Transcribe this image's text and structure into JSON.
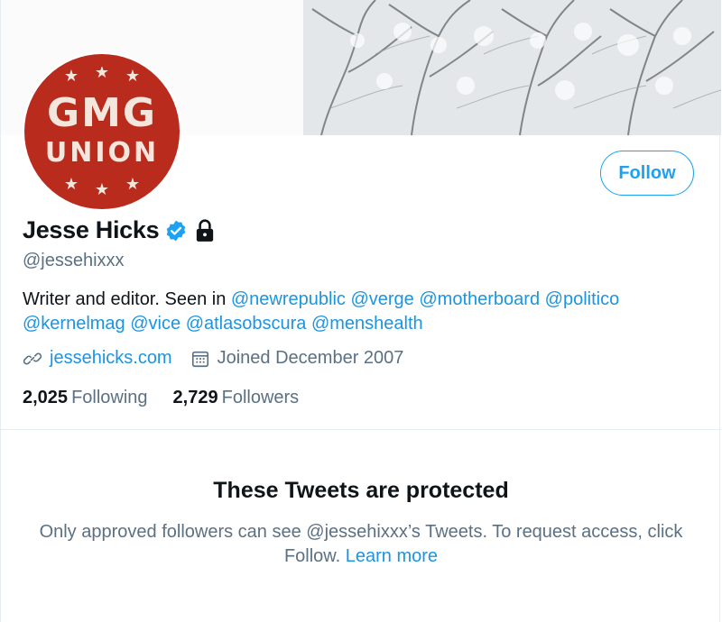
{
  "profile": {
    "name": "Jesse Hicks",
    "handle": "@jessehixxx",
    "avatar": {
      "line1": "GMG",
      "line2": "UNION"
    },
    "bio_prefix": "Writer and editor. Seen in",
    "mentions": [
      "@newrepublic",
      "@verge",
      "@motherboard",
      "@politico",
      "@kernelmag",
      "@vice",
      "@atlasobscura",
      "@menshealth"
    ],
    "website": "jessehicks.com",
    "joined": "Joined December 2007",
    "following_count": "2,025",
    "following_label": "Following",
    "followers_count": "2,729",
    "followers_label": "Followers"
  },
  "actions": {
    "follow_label": "Follow"
  },
  "protected": {
    "title": "These Tweets are protected",
    "text": "Only approved followers can see @jessehixxx’s Tweets. To request access, click Follow.",
    "learn_more": "Learn more"
  },
  "icons": {
    "verified": "verified-badge-icon",
    "locked": "lock-icon",
    "link": "link-icon",
    "calendar": "calendar-icon"
  },
  "colors": {
    "accent": "#1da1f2",
    "link": "#1b95e0",
    "secondary_text": "#5b7083",
    "avatar_bg": "#b82b1d"
  }
}
